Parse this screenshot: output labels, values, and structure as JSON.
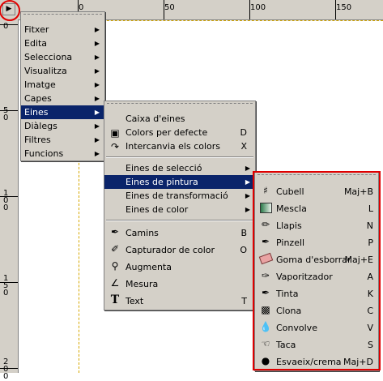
{
  "rulers": {
    "horizontal_labels": [
      "0",
      "50",
      "100",
      "150"
    ],
    "vertical_labels": [
      "0",
      "50",
      "100",
      "150",
      "200"
    ],
    "menu_button_icon": "triangle-right-icon"
  },
  "main_menu": {
    "items": [
      {
        "label": "Fitxer",
        "submenu": true
      },
      {
        "label": "Edita",
        "submenu": true
      },
      {
        "label": "Selecciona",
        "submenu": true
      },
      {
        "label": "Visualitza",
        "submenu": true
      },
      {
        "label": "Imatge",
        "submenu": true
      },
      {
        "label": "Capes",
        "submenu": true
      },
      {
        "label": "Eines",
        "submenu": true,
        "selected": true
      },
      {
        "label": "Diàlegs",
        "submenu": true
      },
      {
        "label": "Filtres",
        "submenu": true
      },
      {
        "label": "Funcions",
        "submenu": true
      }
    ]
  },
  "tools_menu": {
    "top_items": [
      {
        "label": "Caixa d'eines",
        "shortcut": "",
        "icon": ""
      },
      {
        "label": "Colors per defecte",
        "shortcut": "D",
        "icon": "default-colors-icon"
      },
      {
        "label": "Intercanvia els colors",
        "shortcut": "X",
        "icon": "swap-colors-icon"
      }
    ],
    "sub_items": [
      {
        "label": "Eines de selecció"
      },
      {
        "label": "Eines de pintura",
        "selected": true
      },
      {
        "label": "Eines de transformació"
      },
      {
        "label": "Eines de color"
      }
    ],
    "bottom_items": [
      {
        "label": "Camins",
        "shortcut": "B",
        "icon": "paths-icon"
      },
      {
        "label": "Capturador de color",
        "shortcut": "O",
        "icon": "color-picker-icon"
      },
      {
        "label": "Augmenta",
        "shortcut": "",
        "icon": "zoom-icon"
      },
      {
        "label": "Mesura",
        "shortcut": "",
        "icon": "measure-icon"
      },
      {
        "label": "Text",
        "shortcut": "T",
        "icon": "text-icon"
      }
    ]
  },
  "paint_menu": {
    "items": [
      {
        "label": "Cubell",
        "shortcut": "Maj+B",
        "icon": "bucket-fill-icon"
      },
      {
        "label": "Mescla",
        "shortcut": "L",
        "icon": "blend-icon"
      },
      {
        "label": "Llapis",
        "shortcut": "N",
        "icon": "pencil-icon"
      },
      {
        "label": "Pinzell",
        "shortcut": "P",
        "icon": "paintbrush-icon"
      },
      {
        "label": "Goma d'esborrar",
        "shortcut": "Maj+E",
        "icon": "eraser-icon"
      },
      {
        "label": "Vaporitzador",
        "shortcut": "A",
        "icon": "airbrush-icon"
      },
      {
        "label": "Tinta",
        "shortcut": "K",
        "icon": "ink-icon"
      },
      {
        "label": "Clona",
        "shortcut": "C",
        "icon": "clone-icon"
      },
      {
        "label": "Convolve",
        "shortcut": "V",
        "icon": "convolve-icon"
      },
      {
        "label": "Taca",
        "shortcut": "S",
        "icon": "smudge-icon"
      },
      {
        "label": "Esvaeix/crema",
        "shortcut": "Maj+D",
        "icon": "dodge-burn-icon"
      }
    ]
  },
  "colors": {
    "menu_bg": "#d4d0c8",
    "highlight": "#0a246a",
    "annotation": "#e00000"
  }
}
